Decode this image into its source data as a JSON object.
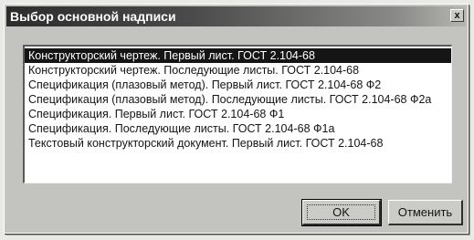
{
  "dialog": {
    "title": "Выбор основной надписи",
    "close_label": "x"
  },
  "list": {
    "items": [
      {
        "label": "Конструкторский чертеж. Первый лист. ГОСТ 2.104-68",
        "selected": true
      },
      {
        "label": "Конструкторский чертеж. Последующие листы. ГОСТ 2.104-68",
        "selected": false
      },
      {
        "label": "Спецификация (плазовый метод). Первый лист. ГОСТ 2.104-68 Ф2",
        "selected": false
      },
      {
        "label": "Спецификация (плазовый метод). Последующие листы. ГОСТ 2.104-68 Ф2а",
        "selected": false
      },
      {
        "label": "Спецификация. Первый лист. ГОСТ 2.104-68 Ф1",
        "selected": false
      },
      {
        "label": "Спецификация. Последующие листы. ГОСТ 2.104-68 Ф1а",
        "selected": false
      },
      {
        "label": "Текстовый конструкторский документ. Первый лист. ГОСТ 2.104-68",
        "selected": false
      }
    ]
  },
  "buttons": {
    "ok_label": "OK",
    "cancel_label": "Отменить"
  }
}
